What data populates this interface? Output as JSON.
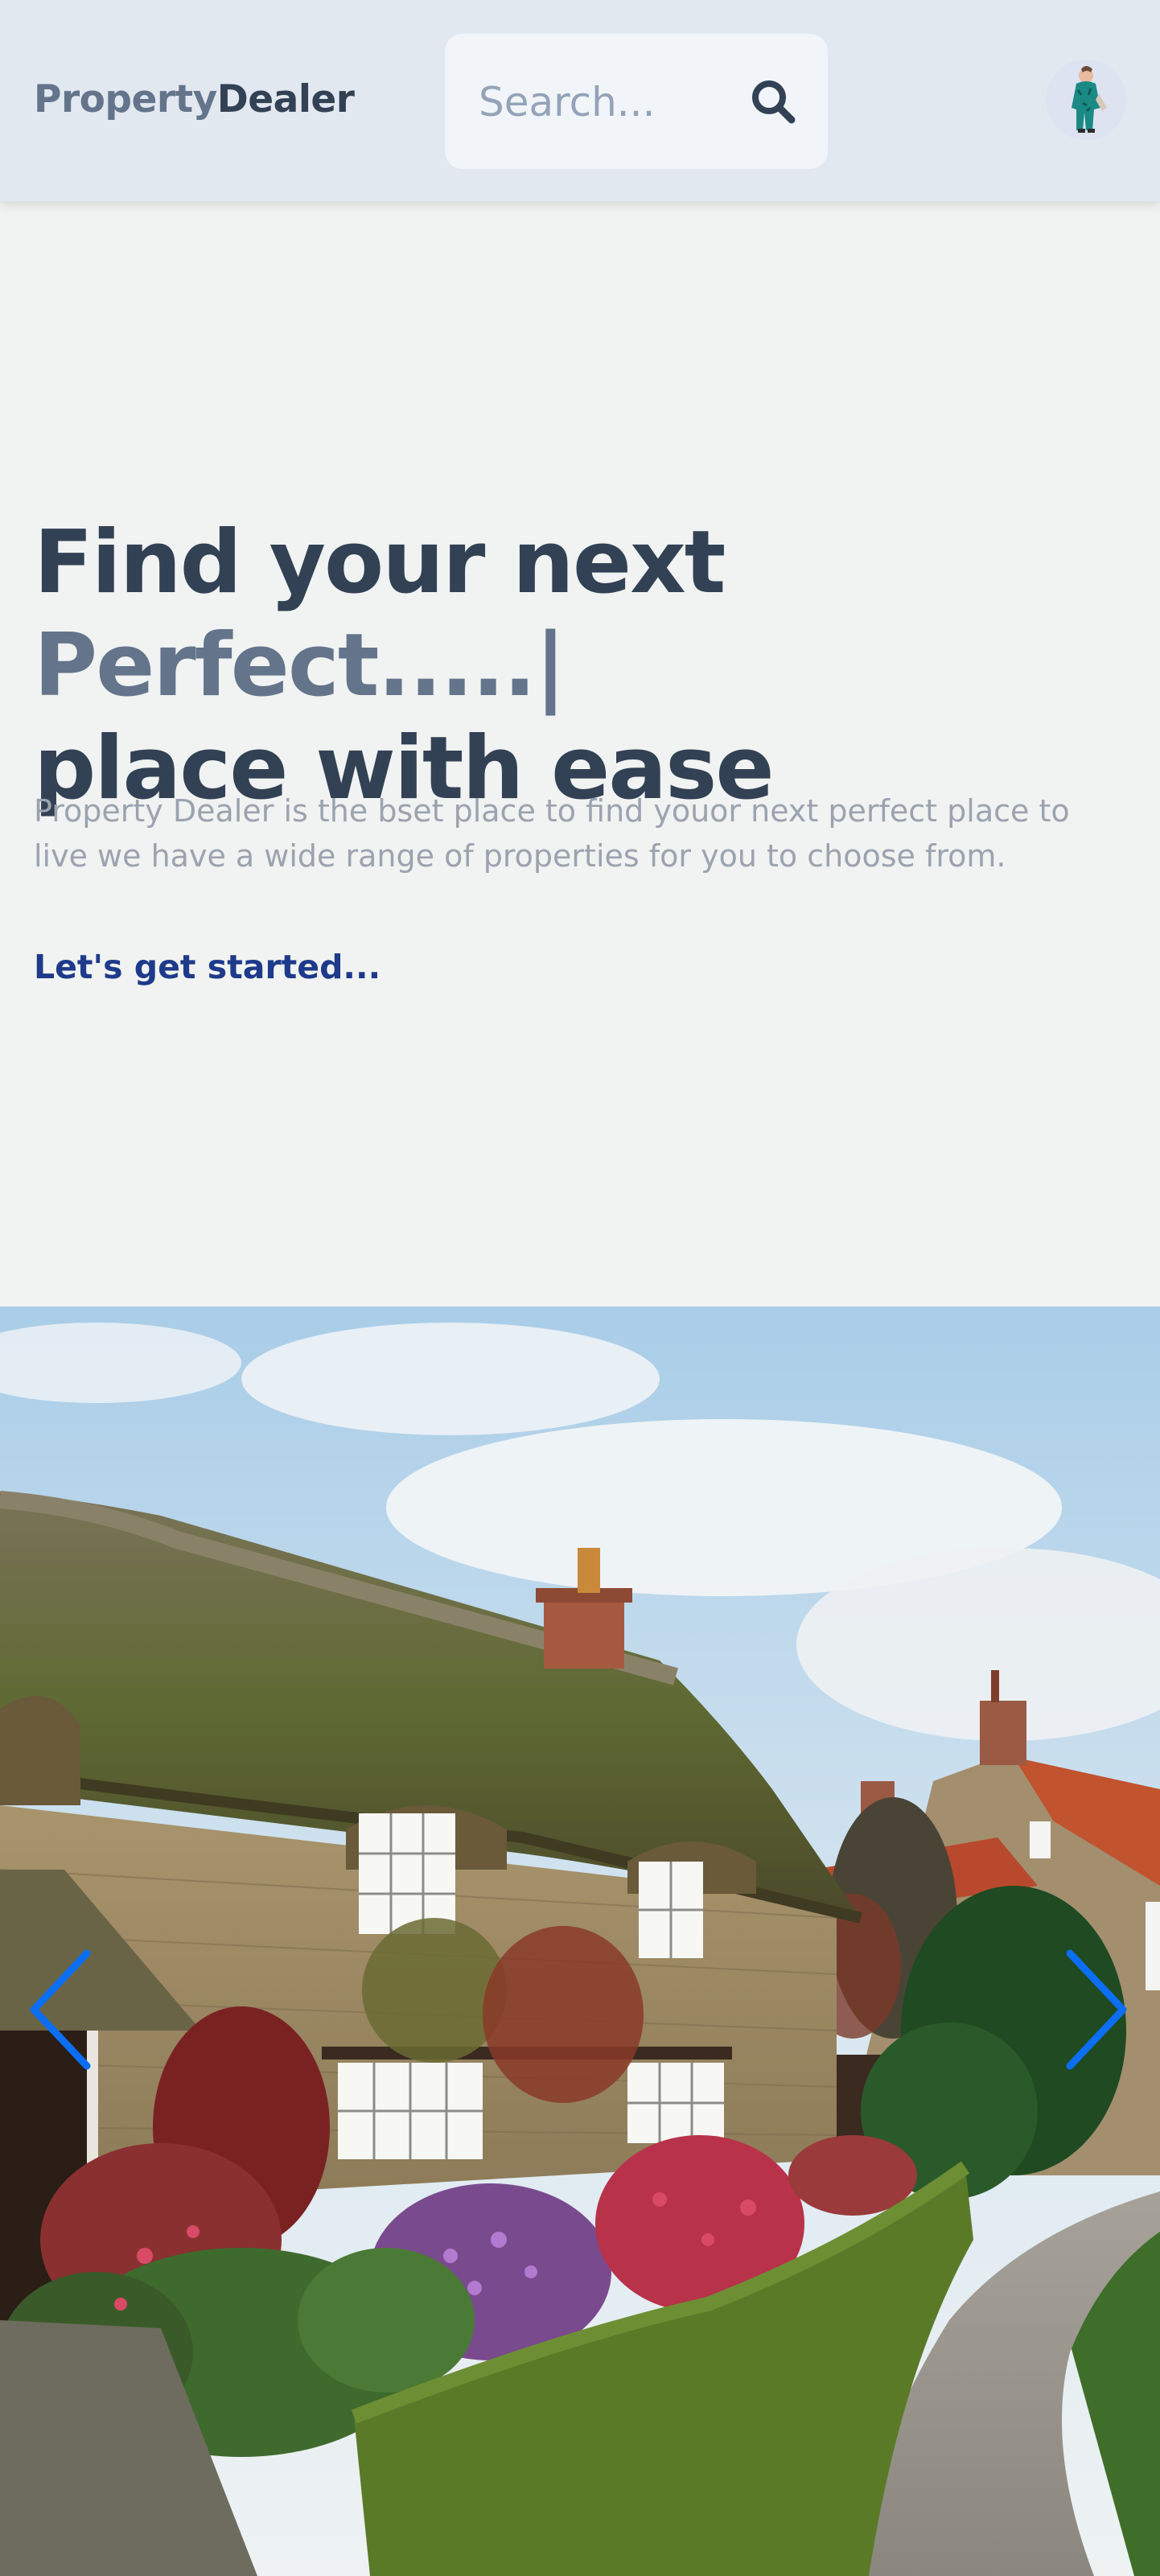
{
  "header": {
    "logo_part1": "Property",
    "logo_part2": "Dealer",
    "search": {
      "placeholder": "Search..."
    },
    "icons": {
      "search": "search-icon",
      "avatar": "user-avatar"
    }
  },
  "hero": {
    "title_line1": "Find your next ",
    "title_typed": "Perfect.....|",
    "title_line2": "place with ease",
    "description": "Property Dealer is the bset place to find youor next perfect place to live we have a wide range of properties for you to choose from.",
    "cta_label": "Let's get started..."
  },
  "slider": {
    "image_subject": "thatched stone cottage with flower garden",
    "icons": {
      "prev": "chevron-left-icon",
      "next": "chevron-right-icon"
    },
    "arrow_color": "#0b6ef3"
  },
  "colors": {
    "header_bg": "#e2e8f0",
    "page_bg": "#f0f3f1",
    "heading": "#334155",
    "accent_muted": "#64748b",
    "cta": "#1e3a8a"
  }
}
